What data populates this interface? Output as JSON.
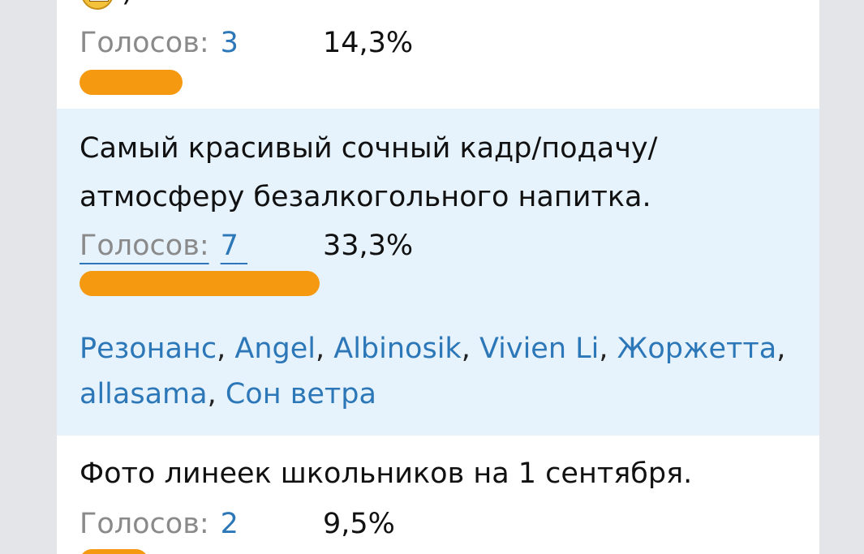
{
  "options": [
    {
      "title_lines": [],
      "tail_text": ")",
      "votes_label": "Голосов:",
      "votes_count": "3",
      "percent": "14,3%",
      "share": 0.143
    },
    {
      "title_lines": [
        "Самый красивый сочный кадр/подачу/",
        "атмосферу безалкогольного напитка."
      ],
      "votes_label": "Голосов:",
      "votes_count": "7",
      "percent": "33,3%",
      "share": 0.333,
      "voters": [
        "Резонанс",
        "Angel",
        "Albinosik",
        "Vivien Li",
        "Жоржетта",
        "allasama",
        "Сон ветра"
      ]
    },
    {
      "title_lines": [
        "Фото линеек школьников на 1 сентября."
      ],
      "votes_label": "Голосов:",
      "votes_count": "2",
      "percent": "9,5%",
      "share": 0.095
    }
  ],
  "colors": {
    "bar": "#f59a10",
    "highlight": "#e6f2fc",
    "link": "#2c77b8",
    "muted": "#8a8a8a"
  }
}
